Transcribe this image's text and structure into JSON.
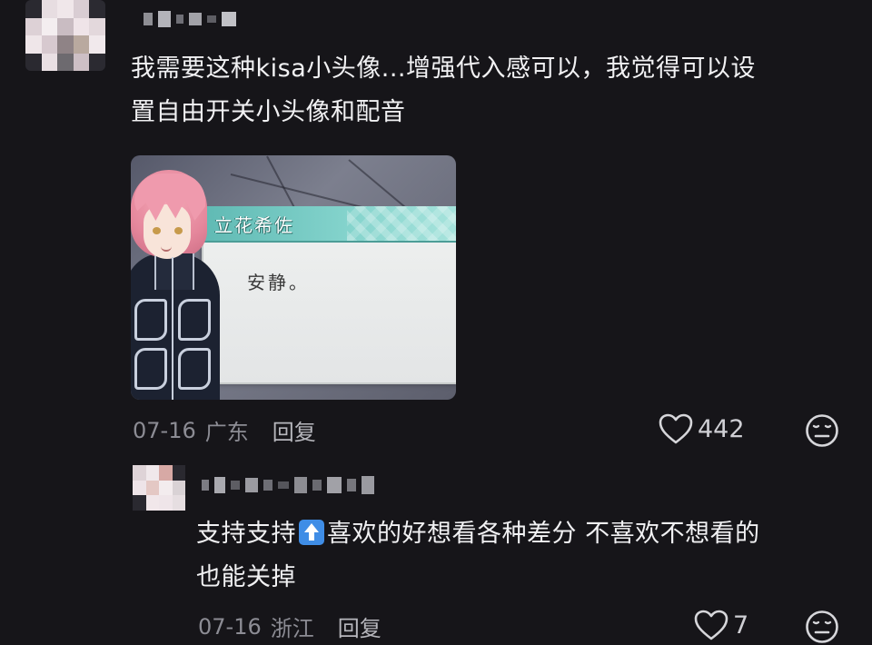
{
  "comment": {
    "text_line1": "我需要这种kisa小头像...增强代入感可以，我觉得可以设",
    "text_line2": "置自由开关小头像和配音",
    "image": {
      "speaker_name": "立花希佐",
      "dialogue": "安静。"
    },
    "date": "07-16",
    "location": "广东",
    "reply_label": "回复",
    "likes": "442",
    "icons": {
      "like": "heart-icon",
      "dislike": "neutral-face-icon"
    }
  },
  "reply": {
    "text_line1_a": "支持支持",
    "text_line1_emoji": "up-arrow-emoji",
    "text_line1_b": "喜欢的好想看各种差分 不喜欢不想看的",
    "text_line2": "也能关掉",
    "date": "07-16",
    "location": "浙江",
    "reply_label": "回复",
    "likes": "7",
    "icons": {
      "like": "heart-icon",
      "dislike": "neutral-face-icon"
    }
  },
  "colors": {
    "background": "#161519",
    "text_primary": "#f1f1f3",
    "text_meta": "#8c8c94",
    "name_bar": "#82d2cb",
    "emoji_bg": "#3f8de6"
  }
}
